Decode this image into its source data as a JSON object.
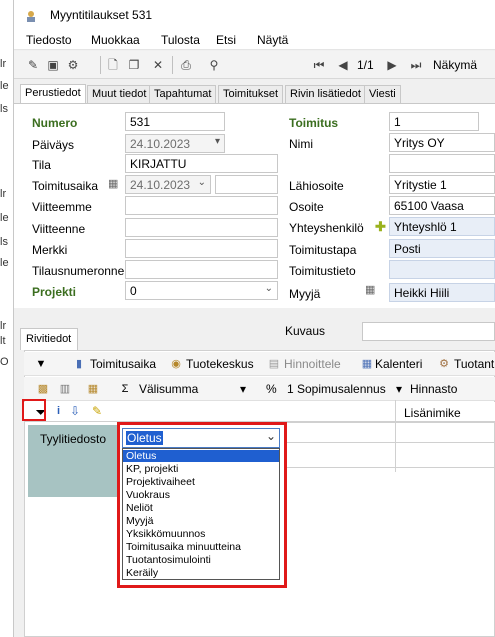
{
  "window": {
    "title": "Myyntitilaukset 531"
  },
  "left_strip": [
    "lr",
    "le",
    "ls",
    "lr",
    "le",
    "ls",
    "le",
    "lr",
    "lt",
    "O"
  ],
  "menu": [
    "Tiedosto",
    "Muokkaa",
    "Tulosta",
    "Etsi",
    "Näytä"
  ],
  "toolbar": {
    "record_counter": "1/1",
    "view_label": "Näkymä"
  },
  "tabs": [
    "Perustiedot",
    "Muut tiedot",
    "Tapahtumat",
    "Toimitukset",
    "Rivin lisätiedot",
    "Viesti"
  ],
  "form": {
    "numero": {
      "label": "Numero",
      "value": "531"
    },
    "paivays": {
      "label": "Päiväys",
      "value": "24.10.2023"
    },
    "tila": {
      "label": "Tila",
      "value": "KIRJATTU"
    },
    "toimitusaika": {
      "label": "Toimitusaika",
      "value": "24.10.2023"
    },
    "viitteemme": {
      "label": "Viitteemme",
      "value": ""
    },
    "viitteenne": {
      "label": "Viitteenne",
      "value": ""
    },
    "merkki": {
      "label": "Merkki",
      "value": ""
    },
    "tilausnumeronne": {
      "label": "Tilausnumeronne",
      "value": ""
    },
    "projekti": {
      "label": "Projekti",
      "value": "0"
    },
    "toimitus": {
      "label": "Toimitus",
      "value": "1"
    },
    "nimi": {
      "label": "Nimi",
      "value": "Yritys OY"
    },
    "lahiosoite": {
      "label": "Lähiosoite",
      "value": "Yritystie 1"
    },
    "osoite": {
      "label": "Osoite",
      "value": "65100  Vaasa"
    },
    "yhteyshenkilo": {
      "label": "Yhteyshenkilö",
      "value": "Yhteyshlö 1"
    },
    "toimitustapa": {
      "label": "Toimitustapa",
      "value": "Posti"
    },
    "toimitustieto": {
      "label": "Toimitustieto",
      "value": ""
    },
    "myyja": {
      "label": "Myyjä",
      "value": "Heikki Hiili"
    }
  },
  "lower": {
    "tab": "Rivitiedot",
    "kuvaus_label": "Kuvaus",
    "toolbar1": [
      "Toimitusaika",
      "Tuotekeskus",
      "Hinnoittele",
      "Kalenteri",
      "Tuotant"
    ],
    "toolbar2": {
      "sum": "Välisumma",
      "percent": "%",
      "discount": "1 Sopimusalennus",
      "price_list": "Hinnasto"
    },
    "column_header": "Lisänimike",
    "style_label": "Tyylitiedosto",
    "combo_value": "Oletus",
    "options": [
      "Oletus",
      "KP, projekti",
      "Projektivaiheet",
      "Vuokraus",
      "Neliöt",
      "Myyjä",
      "Yksikkömuunnos",
      "Toimitusaika minuutteina",
      "Tuotantosimulointi",
      "Keräily"
    ],
    "selected_index": 0
  },
  "colors": {
    "highlight_red": "#e01919",
    "selection_blue": "#1f5fd0",
    "label_green": "#3b6e1f",
    "panel_teal": "#a7c3c2"
  }
}
